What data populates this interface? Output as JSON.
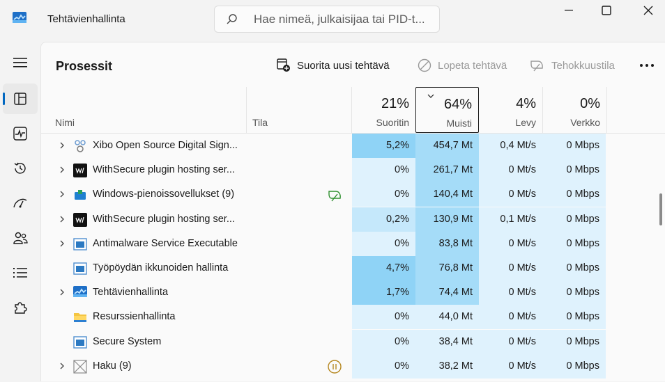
{
  "app": {
    "title": "Tehtävienhallinta"
  },
  "search": {
    "placeholder": "Hae nimeä, julkaisijaa tai PID-t..."
  },
  "toolbar": {
    "page_title": "Prosessit",
    "run_new_task": "Suorita uusi tehtävä",
    "end_task": "Lopeta tehtävä",
    "efficiency_mode": "Tehokkuustila"
  },
  "columns": {
    "name": "Nimi",
    "status": "Tila",
    "cpu": {
      "pct": "21%",
      "label": "Suoritin"
    },
    "memory": {
      "pct": "64%",
      "label": "Muisti"
    },
    "disk": {
      "pct": "4%",
      "label": "Levy"
    },
    "network": {
      "pct": "0%",
      "label": "Verkko"
    }
  },
  "rows": [
    {
      "name": "Xibo Open Source Digital Sign...",
      "icon": "xibo-icon",
      "expandable": true,
      "status": "",
      "cpu": "5,2%",
      "memory": "454,7 Mt",
      "disk": "0,4 Mt/s",
      "network": "0 Mbps"
    },
    {
      "name": "WithSecure plugin hosting ser...",
      "icon": "withsecure-icon",
      "expandable": true,
      "status": "",
      "cpu": "0%",
      "memory": "261,7 Mt",
      "disk": "0 Mt/s",
      "network": "0 Mbps"
    },
    {
      "name": "Windows-pienoissovellukset (9)",
      "icon": "widgets-icon",
      "expandable": true,
      "status": "efficiency-leaf-icon",
      "cpu": "0%",
      "memory": "140,4 Mt",
      "disk": "0 Mt/s",
      "network": "0 Mbps"
    },
    {
      "name": "WithSecure plugin hosting ser...",
      "icon": "withsecure-icon",
      "expandable": true,
      "status": "",
      "cpu": "0,2%",
      "memory": "130,9 Mt",
      "disk": "0,1 Mt/s",
      "network": "0 Mbps"
    },
    {
      "name": "Antimalware Service Executable",
      "icon": "service-window-icon",
      "expandable": true,
      "status": "",
      "cpu": "0%",
      "memory": "83,8 Mt",
      "disk": "0 Mt/s",
      "network": "0 Mbps"
    },
    {
      "name": "Työpöydän ikkunoiden hallinta",
      "icon": "service-window-icon",
      "expandable": false,
      "status": "",
      "cpu": "4,7%",
      "memory": "76,8 Mt",
      "disk": "0 Mt/s",
      "network": "0 Mbps"
    },
    {
      "name": "Tehtävienhallinta",
      "icon": "task-manager-icon",
      "expandable": true,
      "status": "",
      "cpu": "1,7%",
      "memory": "74,4 Mt",
      "disk": "0 Mt/s",
      "network": "0 Mbps"
    },
    {
      "name": "Resurssienhallinta",
      "icon": "folder-icon",
      "expandable": false,
      "status": "",
      "cpu": "0%",
      "memory": "44,0 Mt",
      "disk": "0 Mt/s",
      "network": "0 Mbps"
    },
    {
      "name": "Secure System",
      "icon": "service-window-icon",
      "expandable": false,
      "status": "",
      "cpu": "0%",
      "memory": "38,4 Mt",
      "disk": "0 Mt/s",
      "network": "0 Mbps"
    },
    {
      "name": "Haku (9)",
      "icon": "search-app-icon",
      "expandable": true,
      "status": "paused-icon",
      "cpu": "0%",
      "memory": "38,2 Mt",
      "disk": "0 Mt/s",
      "network": "0 Mbps"
    }
  ],
  "colors": {
    "accent": "#0067c0",
    "heat_low": "#dff2fd",
    "heat_mid": "#c5e8fb",
    "heat_high": "#a5dcf8",
    "heat_max": "#8fd3f6",
    "efficiency_green": "#2f8f2f",
    "paused_amber": "#b5871f"
  }
}
